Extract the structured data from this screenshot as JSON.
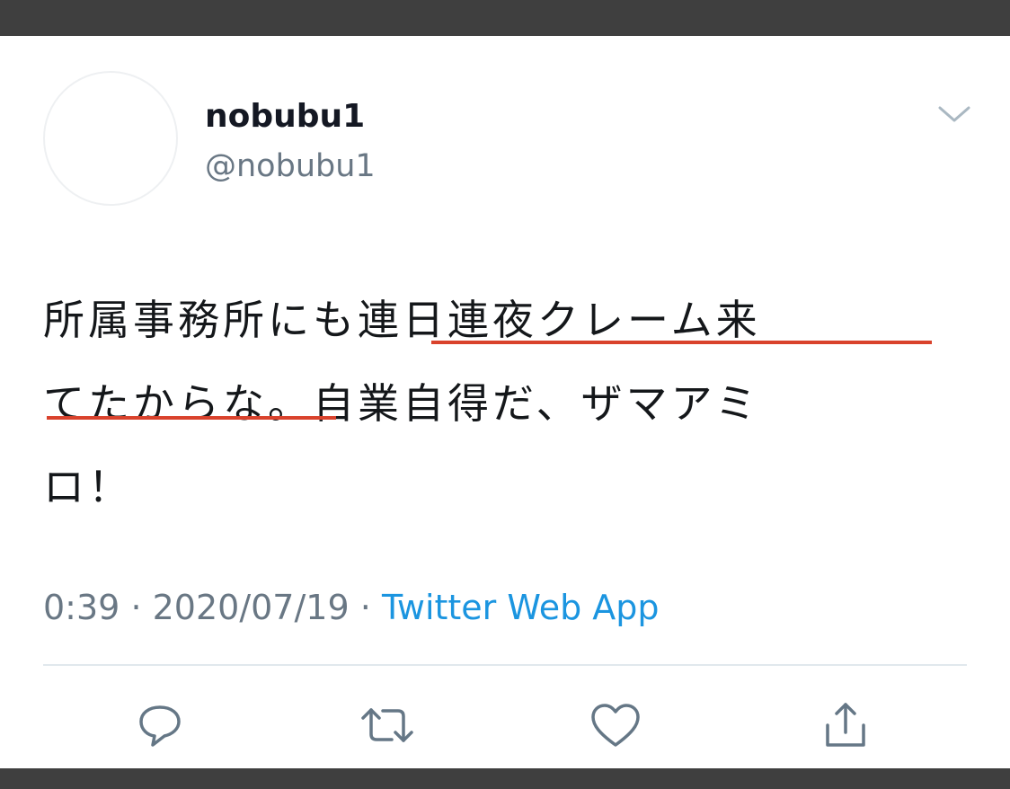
{
  "tweet": {
    "display_name": "nobubu1",
    "handle": "@nobubu1",
    "text_lines": [
      "所属事務所にも連日連夜クレーム来",
      "てたからな。自業自得だ、ザマアミ",
      "ロ！"
    ],
    "time": "0:39",
    "separator": "·",
    "date": "2020/07/19",
    "source": "Twitter Web App",
    "colors": {
      "source_link": "#1b95e0",
      "underline": "#d9422c"
    }
  },
  "icons": {
    "menu": "chevron-down-icon",
    "reply": "reply-icon",
    "retweet": "retweet-icon",
    "like": "heart-icon",
    "share": "share-icon"
  }
}
